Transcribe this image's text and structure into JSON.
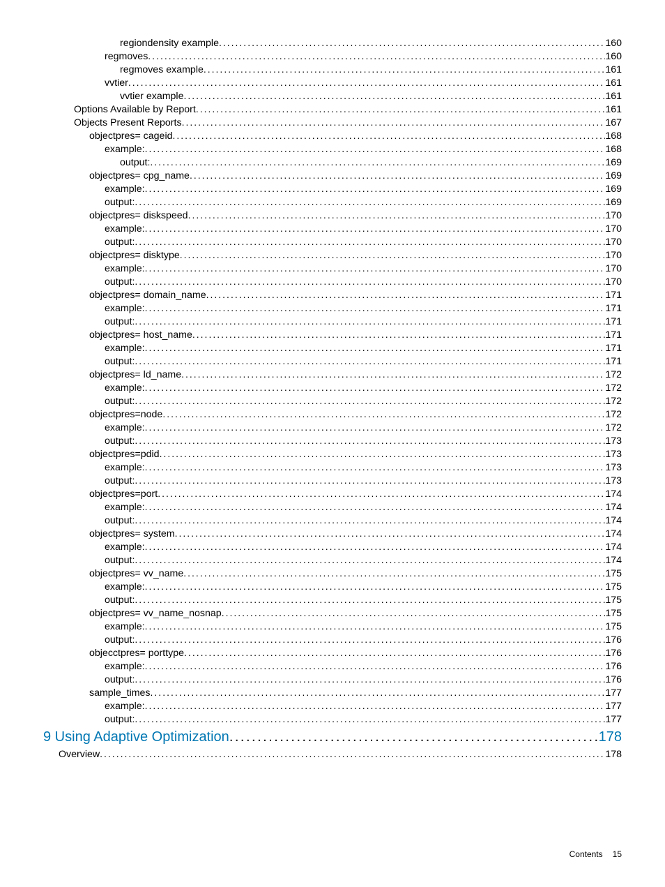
{
  "entries": [
    {
      "label": "regiondensity example",
      "page": "160",
      "indent": 5,
      "chapter": false
    },
    {
      "label": "regmoves",
      "page": "160",
      "indent": 4,
      "chapter": false
    },
    {
      "label": "regmoves example",
      "page": "161",
      "indent": 5,
      "chapter": false
    },
    {
      "label": "vvtier",
      "page": "161",
      "indent": 4,
      "chapter": false
    },
    {
      "label": "vvtier example",
      "page": "161",
      "indent": 5,
      "chapter": false
    },
    {
      "label": "Options Available by Report",
      "page": "161",
      "indent": 2,
      "chapter": false
    },
    {
      "label": "Objects Present Reports",
      "page": "167",
      "indent": 2,
      "chapter": false
    },
    {
      "label": "objectpres= cageid",
      "page": "168",
      "indent": 3,
      "chapter": false
    },
    {
      "label": "example:",
      "page": "168",
      "indent": 4,
      "chapter": false
    },
    {
      "label": "output:",
      "page": "169",
      "indent": 5,
      "chapter": false
    },
    {
      "label": "objectpres= cpg_name",
      "page": "169",
      "indent": 3,
      "chapter": false
    },
    {
      "label": "example:",
      "page": "169",
      "indent": 4,
      "chapter": false
    },
    {
      "label": "output:",
      "page": "169",
      "indent": 4,
      "chapter": false
    },
    {
      "label": "objectpres= diskspeed",
      "page": "170",
      "indent": 3,
      "chapter": false
    },
    {
      "label": "example:",
      "page": "170",
      "indent": 4,
      "chapter": false
    },
    {
      "label": "output:",
      "page": "170",
      "indent": 4,
      "chapter": false
    },
    {
      "label": "objectpres= disktype",
      "page": "170",
      "indent": 3,
      "chapter": false
    },
    {
      "label": "example:",
      "page": "170",
      "indent": 4,
      "chapter": false
    },
    {
      "label": "output:",
      "page": "170",
      "indent": 4,
      "chapter": false
    },
    {
      "label": "objectpres= domain_name",
      "page": "171",
      "indent": 3,
      "chapter": false
    },
    {
      "label": "example:",
      "page": "171",
      "indent": 4,
      "chapter": false
    },
    {
      "label": "output:",
      "page": "171",
      "indent": 4,
      "chapter": false
    },
    {
      "label": "objectpres= host_name",
      "page": "171",
      "indent": 3,
      "chapter": false
    },
    {
      "label": "example:",
      "page": "171",
      "indent": 4,
      "chapter": false
    },
    {
      "label": "output:",
      "page": "171",
      "indent": 4,
      "chapter": false
    },
    {
      "label": "objectpres= ld_name",
      "page": "172",
      "indent": 3,
      "chapter": false
    },
    {
      "label": "example:",
      "page": "172",
      "indent": 4,
      "chapter": false
    },
    {
      "label": "output:",
      "page": "172",
      "indent": 4,
      "chapter": false
    },
    {
      "label": "objectpres=node",
      "page": "172",
      "indent": 3,
      "chapter": false
    },
    {
      "label": "example:",
      "page": "172",
      "indent": 4,
      "chapter": false
    },
    {
      "label": "output:",
      "page": "173",
      "indent": 4,
      "chapter": false
    },
    {
      "label": "objectpres=pdid",
      "page": "173",
      "indent": 3,
      "chapter": false
    },
    {
      "label": "example:",
      "page": "173",
      "indent": 4,
      "chapter": false
    },
    {
      "label": "output:",
      "page": "173",
      "indent": 4,
      "chapter": false
    },
    {
      "label": "objectpres=port",
      "page": "174",
      "indent": 3,
      "chapter": false
    },
    {
      "label": "example:",
      "page": "174",
      "indent": 4,
      "chapter": false
    },
    {
      "label": "output:",
      "page": "174",
      "indent": 4,
      "chapter": false
    },
    {
      "label": "objectpres= system",
      "page": "174",
      "indent": 3,
      "chapter": false
    },
    {
      "label": "example:",
      "page": "174",
      "indent": 4,
      "chapter": false
    },
    {
      "label": "output:",
      "page": "174",
      "indent": 4,
      "chapter": false
    },
    {
      "label": "objectpres= vv_name",
      "page": "175",
      "indent": 3,
      "chapter": false
    },
    {
      "label": "example:",
      "page": "175",
      "indent": 4,
      "chapter": false
    },
    {
      "label": "output:",
      "page": "175",
      "indent": 4,
      "chapter": false
    },
    {
      "label": "objectpres= vv_name_nosnap",
      "page": "175",
      "indent": 3,
      "chapter": false
    },
    {
      "label": "example:",
      "page": "175",
      "indent": 4,
      "chapter": false
    },
    {
      "label": "output:",
      "page": "176",
      "indent": 4,
      "chapter": false
    },
    {
      "label": "objecctpres= porttype",
      "page": "176",
      "indent": 3,
      "chapter": false
    },
    {
      "label": "example:",
      "page": "176",
      "indent": 4,
      "chapter": false
    },
    {
      "label": "output:",
      "page": "176",
      "indent": 4,
      "chapter": false
    },
    {
      "label": "sample_times",
      "page": "177",
      "indent": 3,
      "chapter": false
    },
    {
      "label": "example:",
      "page": "177",
      "indent": 4,
      "chapter": false
    },
    {
      "label": "output:",
      "page": "177",
      "indent": 4,
      "chapter": false
    },
    {
      "label": "9 Using Adaptive Optimization",
      "page": "178",
      "indent": 0,
      "chapter": true
    },
    {
      "label": "Overview",
      "page": "178",
      "indent": 1,
      "chapter": false
    }
  ],
  "footer": {
    "label": "Contents",
    "page": "15"
  }
}
